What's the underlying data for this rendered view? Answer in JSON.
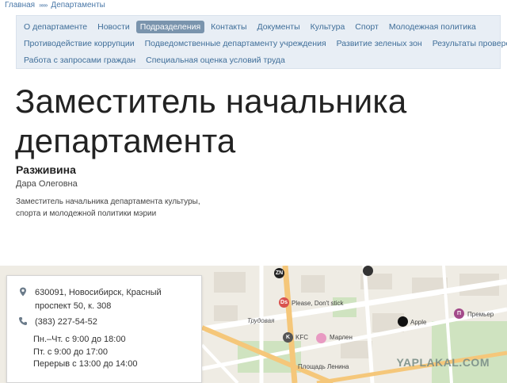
{
  "breadcrumb": {
    "home": "Главная",
    "separator": "»»»",
    "current": "Департаменты"
  },
  "subnav": {
    "rows": [
      [
        "О департаменте",
        "Новости",
        "Подразделения",
        "Контакты",
        "Документы",
        "Культура",
        "Спорт",
        "Молодежная политика"
      ],
      [
        "Противодействие коррупции",
        "Подведомственные департаменту учреждения",
        "Развитие зеленых зон",
        "Результаты проверок"
      ],
      [
        "Работа с запросами граждан",
        "Специальная оценка условий труда"
      ]
    ],
    "active": "Подразделения",
    "dropdown_item": "Результаты проверок"
  },
  "page": {
    "title": "Заместитель начальника департамента"
  },
  "person": {
    "surname": "Разживина",
    "name": "Дара Олеговна",
    "position": "Заместитель начальника департамента культуры, спорта и молодежной политики мэрии"
  },
  "contact": {
    "address": "630091, Новосибирск, Красный проспект 50, к. 308",
    "phone": "(383) 227-54-52",
    "hours": [
      "Пн.–Чт. с 9:00 до 18:00",
      "Пт. с 9:00 до 17:00",
      "Перерыв с 13:00 до 14:00"
    ]
  },
  "map": {
    "labels": {
      "trudovaya": "Трудовая",
      "please": "Please, Don't stick",
      "kfc": "KFC",
      "marlen": "Марлен",
      "apple": "Apple",
      "premier": "Премьер",
      "lenina": "Площадь Ленина"
    },
    "poi_letters": {
      "zn": "ZN",
      "ds": "Ds",
      "kfc": "K",
      "premier": "П"
    },
    "watermark": "YAPLAKAL.COM"
  },
  "colors": {
    "link": "#3f6e99",
    "nav_bg": "#e8eef5",
    "active_tab": "#7a94ad",
    "map_bg": "#efece4",
    "road": "#f5c77a"
  }
}
